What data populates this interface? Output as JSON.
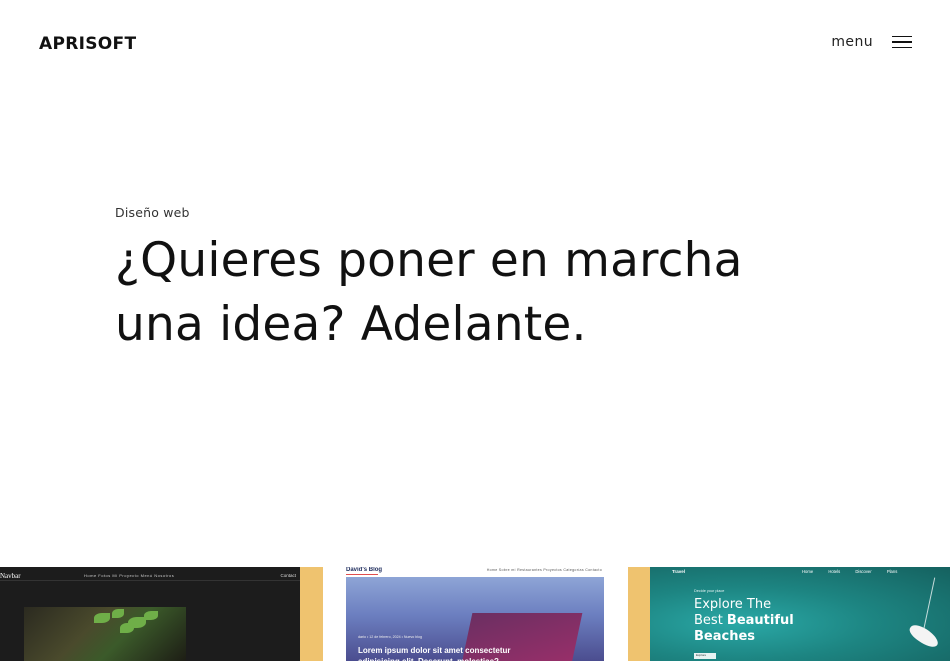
{
  "header": {
    "logo": "APRISOFT",
    "menu_label": "menu",
    "menu_icon": "hamburger-icon"
  },
  "hero": {
    "kicker": "Diseño web",
    "title_line1": "¿Quieres poner en marcha",
    "title_line2": "una idea? Adelante."
  },
  "portfolio": {
    "cards": [
      {
        "brand": "Navbar",
        "nav_links": "Home  Fotos  Mi Proyecto  Menú  Nosotros",
        "nav_contact": "Contact",
        "accent_color": "#efc36f"
      },
      {
        "brand": "David's Blog",
        "nav_links": "Home    Sobre mí    Restaurantes    Proyectos    Categorías    Contacto",
        "meta": "dario  •  12 de febrero, 2024  •  Nuevo blog",
        "headline": "Lorem ipsum dolor sit amet consectetur adipisicing elit. Deserunt, molestiae?"
      },
      {
        "brand": "Travel",
        "nav_links": "Home Hotels Discover Plans",
        "kicker": "Decide your place",
        "title_line1": "Explore The",
        "title_line2_plain": "Best ",
        "title_line2_bold": "Beautiful",
        "title_line3_bold": "Beaches",
        "button": "Explore",
        "accent_color": "#efc36f"
      }
    ]
  }
}
